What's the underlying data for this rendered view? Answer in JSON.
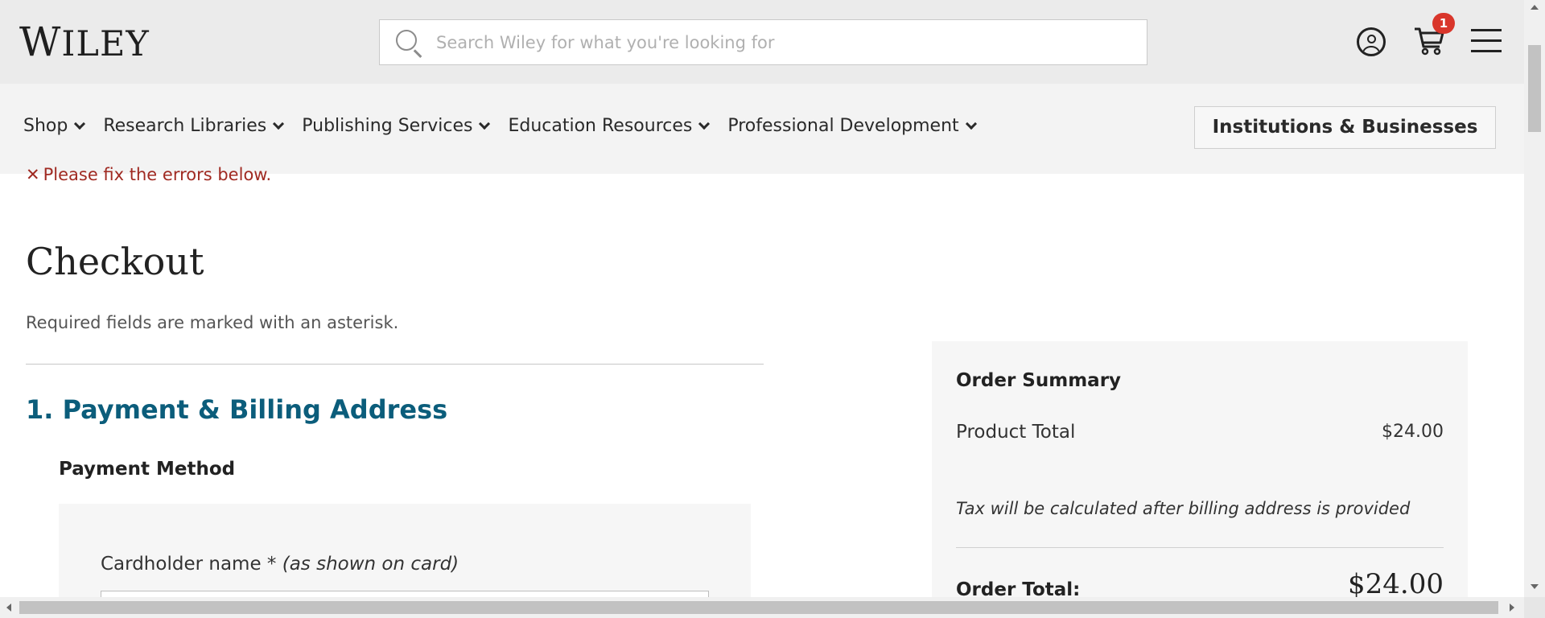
{
  "header": {
    "logo_text": "WILEY",
    "search_placeholder": "Search Wiley for what you're looking for",
    "cart_count": "1"
  },
  "nav": {
    "items": [
      {
        "label": "Shop"
      },
      {
        "label": "Research Libraries"
      },
      {
        "label": "Publishing Services"
      },
      {
        "label": "Education Resources"
      },
      {
        "label": "Professional Development"
      }
    ],
    "institutions_button": "Institutions & Businesses"
  },
  "checkout": {
    "error_message": "Please fix the errors below.",
    "title": "Checkout",
    "required_note": "Required fields are marked with an asterisk.",
    "section_title": "1. Payment & Billing Address",
    "payment_method_label": "Payment Method",
    "cardholder_label": "Cardholder name *",
    "cardholder_hint": "(as shown on card)",
    "cardholder_value": ""
  },
  "order_summary": {
    "title": "Order Summary",
    "product_total_label": "Product Total",
    "product_total_value": "$24.00",
    "tax_note": "Tax will be calculated after billing address is provided",
    "order_total_label": "Order Total:",
    "order_total_value": "$24.00"
  },
  "icons": {
    "search": "search-icon",
    "account": "account-icon",
    "cart": "cart-icon",
    "menu": "hamburger-menu-icon",
    "error": "close-icon",
    "chevron": "chevron-down-icon"
  },
  "colors": {
    "header_bg": "#ebebeb",
    "nav_bg": "#f3f3f3",
    "section_title": "#0b5d7b",
    "error": "#a02a22",
    "cart_badge": "#d9362b",
    "panel_bg": "#f6f6f6"
  }
}
